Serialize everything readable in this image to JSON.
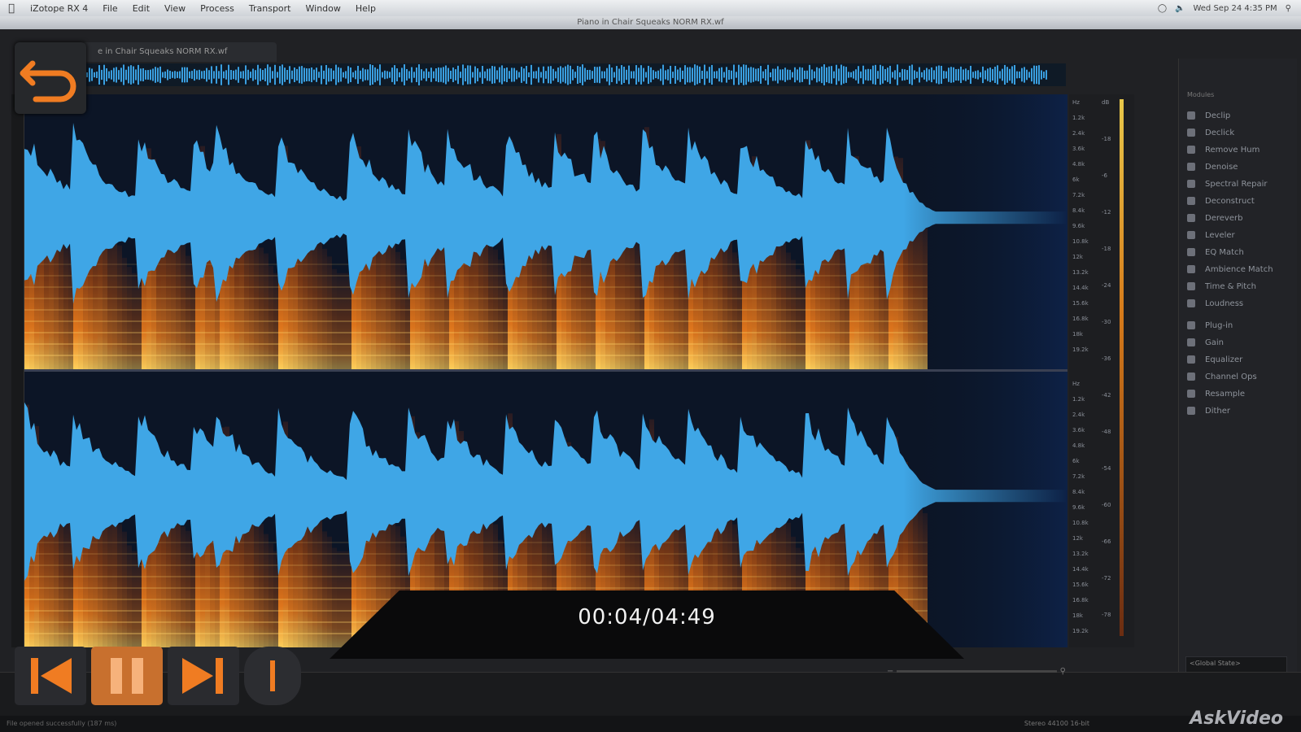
{
  "menubar": {
    "items": [
      "iZotope RX 4",
      "File",
      "Edit",
      "View",
      "Process",
      "Transport",
      "Window",
      "Help"
    ],
    "clock": "Wed Sep 24 4:35 PM"
  },
  "window": {
    "title": "Piano in Chair Squeaks NORM RX.wf",
    "file_tab": "e in Chair Squeaks NORM RX.wf"
  },
  "brand": {
    "logo_text": "iZotope"
  },
  "modules_panel": {
    "title": "Modules",
    "items": [
      {
        "label": "Declip",
        "icon": "declip-icon"
      },
      {
        "label": "Declick",
        "icon": "declick-icon"
      },
      {
        "label": "Remove Hum",
        "icon": "hum-icon"
      },
      {
        "label": "Denoise",
        "icon": "denoise-icon"
      },
      {
        "label": "Spectral Repair",
        "icon": "repair-icon"
      },
      {
        "label": "Deconstruct",
        "icon": "deconstruct-icon"
      },
      {
        "label": "Dereverb",
        "icon": "dereverb-icon"
      },
      {
        "label": "Leveler",
        "icon": "leveler-icon"
      },
      {
        "label": "EQ Match",
        "icon": "eq-match-icon"
      },
      {
        "label": "Ambience Match",
        "icon": "ambience-icon"
      },
      {
        "label": "Time & Pitch",
        "icon": "time-pitch-icon"
      },
      {
        "label": "Loudness",
        "icon": "loudness-icon"
      },
      {
        "label": "Plug-in",
        "icon": "plugin-icon"
      },
      {
        "label": "Gain",
        "icon": "gain-icon"
      },
      {
        "label": "Equalizer",
        "icon": "equalizer-icon"
      },
      {
        "label": "Channel Ops",
        "icon": "channel-ops-icon"
      },
      {
        "label": "Resample",
        "icon": "resample-icon"
      },
      {
        "label": "Dither",
        "icon": "dither-icon"
      }
    ],
    "state_label": "<Global State>"
  },
  "scale": {
    "hz_top": [
      "Hz",
      "1.2k",
      "2.4k",
      "3.6k",
      "4.8k",
      "6k",
      "7.2k",
      "8.4k",
      "9.6k",
      "10.8k",
      "12k",
      "13.2k",
      "14.4k",
      "15.6k",
      "16.8k",
      "18k",
      "19.2k"
    ],
    "db": [
      "dB",
      "-18",
      "-6",
      "-12",
      "-18",
      "-24",
      "-30",
      "-36",
      "-42",
      "-48",
      "-54",
      "-60",
      "-66",
      "-72",
      "-78"
    ]
  },
  "playback": {
    "time_display": "00:04/04:49"
  },
  "statusbar": {
    "left": "File opened successfully (187 ms)",
    "right": "Stereo  44100  16-bit"
  },
  "watermark": "AskVideo",
  "colors": {
    "accent_orange": "#f07c22",
    "waveform_blue": "#3fa6e6",
    "spectrogram_bg": "#0c1526"
  }
}
